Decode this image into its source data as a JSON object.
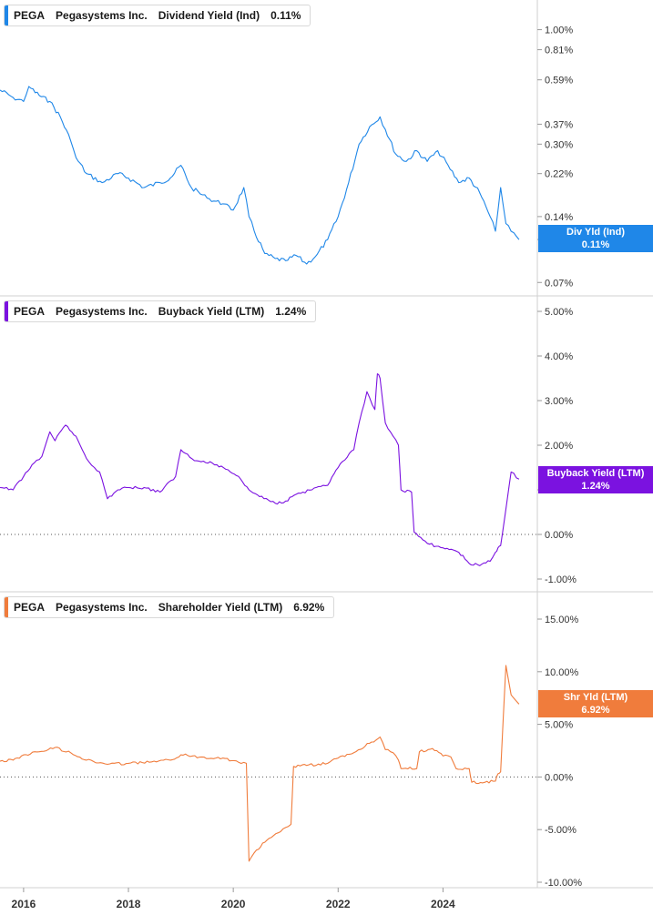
{
  "colors": {
    "dividend": "#1f87e8",
    "buyback": "#7b12e0",
    "shareholder": "#f07c3c",
    "axis_text": "#333333",
    "grid": "#e6e6e6"
  },
  "legends": [
    {
      "ticker": "PEGA",
      "company": "Pegasystems Inc.",
      "metric": "Dividend Yield (Ind)",
      "value": "0.11%"
    },
    {
      "ticker": "PEGA",
      "company": "Pegasystems Inc.",
      "metric": "Buyback Yield (LTM)",
      "value": "1.24%"
    },
    {
      "ticker": "PEGA",
      "company": "Pegasystems Inc.",
      "metric": "Shareholder Yield (LTM)",
      "value": "6.92%"
    }
  ],
  "badges": [
    {
      "label": "Div Yld (Ind)",
      "value": "0.11%"
    },
    {
      "label": "Buyback Yield (LTM)",
      "value": "1.24%"
    },
    {
      "label": "Shr Yld (LTM)",
      "value": "6.92%"
    }
  ],
  "x_axis": {
    "ticks": [
      2016,
      2018,
      2020,
      2022,
      2024
    ],
    "range": [
      2015.55,
      2025.8
    ]
  },
  "chart_data": [
    {
      "type": "line",
      "name": "Dividend Yield (Ind)",
      "y_scale": "log",
      "ylim": [
        0.065,
        1.15
      ],
      "y_ticks": [
        "1.00%",
        "0.81%",
        "0.59%",
        "0.37%",
        "0.30%",
        "0.22%",
        "0.14%",
        "0.11%",
        "0.07%"
      ],
      "y_tick_values": [
        1.0,
        0.81,
        0.59,
        0.37,
        0.3,
        0.22,
        0.14,
        0.11,
        0.07
      ],
      "x": [
        2015.55,
        2015.8,
        2016.0,
        2016.1,
        2016.3,
        2016.5,
        2016.7,
        2016.9,
        2017.0,
        2017.2,
        2017.5,
        2017.8,
        2018.0,
        2018.3,
        2018.6,
        2018.8,
        2019.0,
        2019.2,
        2019.5,
        2019.8,
        2020.0,
        2020.2,
        2020.3,
        2020.4,
        2020.6,
        2020.8,
        2021.0,
        2021.2,
        2021.4,
        2021.6,
        2021.8,
        2022.0,
        2022.2,
        2022.4,
        2022.6,
        2022.8,
        2022.9,
        2023.1,
        2023.3,
        2023.5,
        2023.7,
        2023.9,
        2024.1,
        2024.3,
        2024.5,
        2024.7,
        2024.9,
        2025.0,
        2025.1,
        2025.2,
        2025.3,
        2025.45
      ],
      "y": [
        0.53,
        0.49,
        0.47,
        0.55,
        0.5,
        0.47,
        0.4,
        0.31,
        0.26,
        0.22,
        0.2,
        0.22,
        0.21,
        0.19,
        0.2,
        0.21,
        0.24,
        0.19,
        0.17,
        0.16,
        0.15,
        0.19,
        0.14,
        0.12,
        0.095,
        0.09,
        0.088,
        0.093,
        0.085,
        0.094,
        0.11,
        0.14,
        0.2,
        0.3,
        0.36,
        0.4,
        0.35,
        0.27,
        0.25,
        0.28,
        0.25,
        0.28,
        0.24,
        0.2,
        0.21,
        0.18,
        0.14,
        0.12,
        0.19,
        0.13,
        0.12,
        0.11
      ]
    },
    {
      "type": "line",
      "name": "Buyback Yield (LTM)",
      "y_scale": "linear",
      "ylim": [
        -1.0,
        5.0
      ],
      "y_ticks": [
        "5.00%",
        "4.00%",
        "3.00%",
        "2.00%",
        "1.00%",
        "0.00%",
        "-1.00%"
      ],
      "y_tick_values": [
        5.0,
        4.0,
        3.0,
        2.0,
        1.0,
        0.0,
        -1.0
      ],
      "x": [
        2015.55,
        2015.8,
        2016.0,
        2016.2,
        2016.35,
        2016.5,
        2016.6,
        2016.8,
        2017.0,
        2017.2,
        2017.35,
        2017.45,
        2017.6,
        2017.8,
        2018.0,
        2018.3,
        2018.6,
        2018.9,
        2019.0,
        2019.3,
        2019.6,
        2019.9,
        2020.1,
        2020.3,
        2020.5,
        2020.8,
        2021.0,
        2021.2,
        2021.5,
        2021.8,
        2022.0,
        2022.3,
        2022.4,
        2022.55,
        2022.7,
        2022.75,
        2022.8,
        2022.9,
        2023.05,
        2023.15,
        2023.2,
        2023.4,
        2023.45,
        2023.7,
        2024.0,
        2024.2,
        2024.3,
        2024.5,
        2024.7,
        2024.9,
        2025.0,
        2025.05,
        2025.1,
        2025.3,
        2025.45
      ],
      "y": [
        1.05,
        1.0,
        1.3,
        1.6,
        1.75,
        2.3,
        2.1,
        2.45,
        2.2,
        1.7,
        1.5,
        1.4,
        0.8,
        1.0,
        1.05,
        1.05,
        0.95,
        1.3,
        1.9,
        1.65,
        1.6,
        1.45,
        1.3,
        1.0,
        0.85,
        0.7,
        0.75,
        0.9,
        1.0,
        1.1,
        1.5,
        1.9,
        2.5,
        3.2,
        2.8,
        3.6,
        3.5,
        2.5,
        2.2,
        2.0,
        1.0,
        0.95,
        0.05,
        -0.2,
        -0.3,
        -0.35,
        -0.4,
        -0.65,
        -0.7,
        -0.6,
        -0.4,
        -0.3,
        -0.25,
        1.4,
        1.24
      ]
    },
    {
      "type": "line",
      "name": "Shareholder Yield (LTM)",
      "y_scale": "linear",
      "ylim": [
        -10.0,
        15.0
      ],
      "y_ticks": [
        "15.00%",
        "10.00%",
        "5.00%",
        "0.00%",
        "-5.00%",
        "-10.00%"
      ],
      "y_tick_values": [
        15.0,
        10.0,
        5.0,
        0.0,
        -5.0,
        -10.0
      ],
      "x": [
        2015.55,
        2015.8,
        2016.0,
        2016.3,
        2016.6,
        2016.9,
        2017.2,
        2017.6,
        2018.0,
        2018.4,
        2018.8,
        2019.0,
        2019.4,
        2019.8,
        2020.1,
        2020.25,
        2020.3,
        2020.4,
        2020.6,
        2020.9,
        2021.0,
        2021.1,
        2021.15,
        2021.4,
        2021.8,
        2022.0,
        2022.3,
        2022.6,
        2022.8,
        2022.9,
        2023.05,
        2023.15,
        2023.2,
        2023.5,
        2023.55,
        2023.8,
        2024.0,
        2024.15,
        2024.25,
        2024.5,
        2024.55,
        2024.8,
        2025.0,
        2025.05,
        2025.1,
        2025.2,
        2025.3,
        2025.45
      ],
      "y": [
        1.5,
        1.6,
        2.1,
        2.4,
        2.8,
        2.3,
        1.6,
        1.2,
        1.3,
        1.4,
        1.6,
        2.1,
        1.9,
        1.8,
        1.4,
        1.3,
        -8.0,
        -7.2,
        -6.2,
        -5.2,
        -4.8,
        -4.5,
        1.0,
        1.1,
        1.3,
        1.8,
        2.3,
        3.2,
        3.8,
        2.6,
        2.3,
        1.6,
        0.8,
        0.8,
        2.4,
        2.7,
        2.0,
        1.9,
        0.8,
        0.8,
        -0.5,
        -0.5,
        -0.4,
        0.3,
        0.5,
        10.6,
        7.8,
        6.92
      ]
    }
  ]
}
